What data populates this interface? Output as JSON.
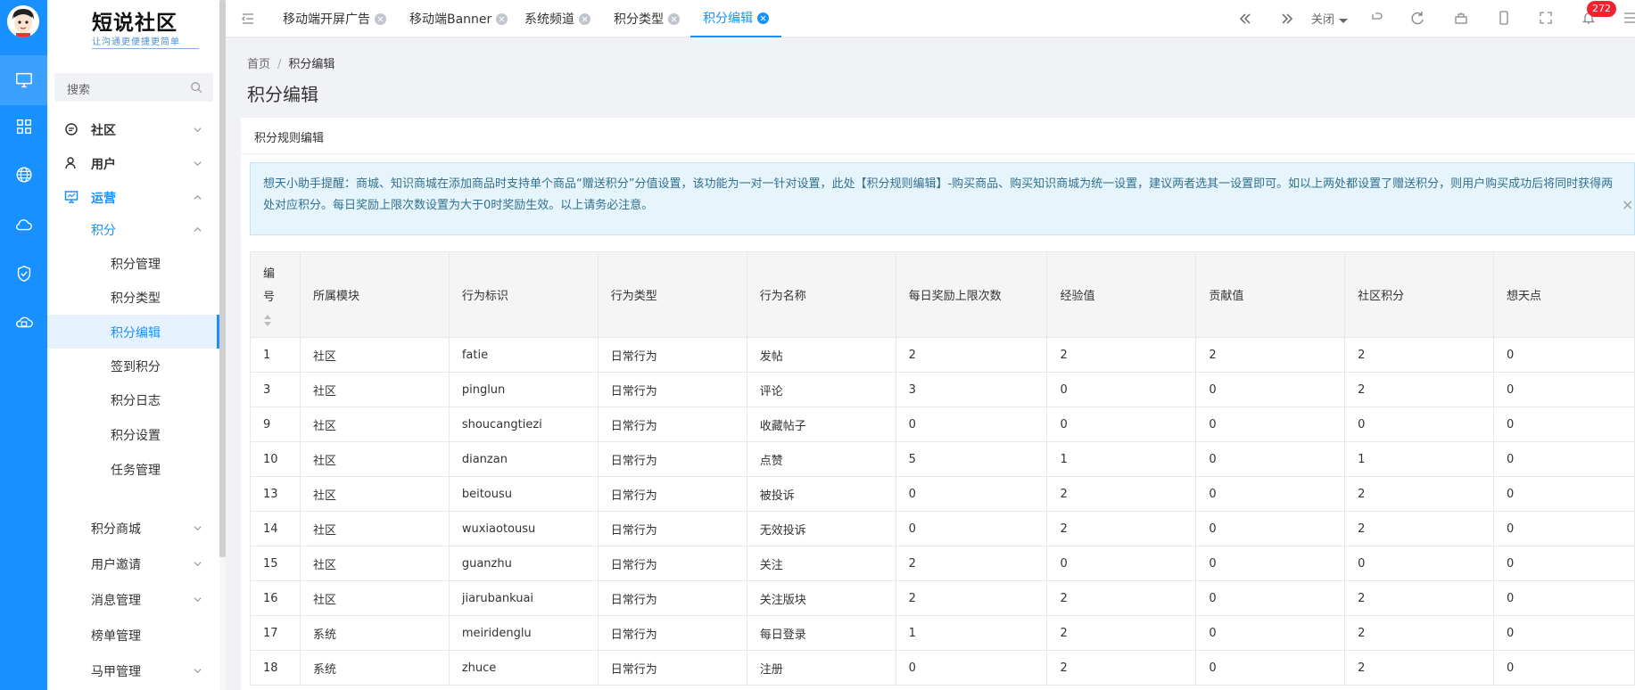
{
  "brand": {
    "title": "短说社区",
    "subtitle": "让沟通更便捷更简单"
  },
  "search": {
    "placeholder": "搜索"
  },
  "sidebar": {
    "items": [
      {
        "label": "社区",
        "icon": "chat-bubble-icon"
      },
      {
        "label": "用户",
        "icon": "user-icon"
      },
      {
        "label": "运营",
        "icon": "monitor-icon"
      },
      {
        "label": "积分"
      },
      {
        "label": "积分管理"
      },
      {
        "label": "积分类型"
      },
      {
        "label": "积分编辑"
      },
      {
        "label": "签到积分"
      },
      {
        "label": "积分日志"
      },
      {
        "label": "积分设置"
      },
      {
        "label": "任务管理"
      },
      {
        "label": "积分商城"
      },
      {
        "label": "用户邀请"
      },
      {
        "label": "消息管理"
      },
      {
        "label": "榜单管理"
      },
      {
        "label": "马甲管理"
      }
    ]
  },
  "tabs": [
    {
      "label": "移动端开屏广告"
    },
    {
      "label": "移动端Banner"
    },
    {
      "label": "系统频道"
    },
    {
      "label": "积分类型"
    },
    {
      "label": "积分编辑"
    }
  ],
  "toolbar": {
    "close_label": "关闭",
    "notification_count": "272"
  },
  "breadcrumb": {
    "home": "首页",
    "current": "积分编辑"
  },
  "page_title": "积分编辑",
  "card": {
    "title": "积分规则编辑",
    "alert": "想天小助手提醒：商城、知识商城在添加商品时支持单个商品“赠送积分”分值设置，该功能为一对一针对设置，此处【积分规则编辑】-购买商品、购买知识商城为统一设置，建议两者选其一设置即可。如以上两处都设置了赠送积分，则用户购买成功后将同时获得两处对应积分。每日奖励上限次数设置为大于0时奖励生效。以上请务必注意。"
  },
  "table": {
    "headers": [
      "编号",
      "所属模块",
      "行为标识",
      "行为类型",
      "行为名称",
      "每日奖励上限次数",
      "经验值",
      "贡献值",
      "社区积分",
      "想天点"
    ],
    "rows": [
      [
        "1",
        "社区",
        "fatie",
        "日常行为",
        "发帖",
        "2",
        "2",
        "2",
        "2",
        "0"
      ],
      [
        "3",
        "社区",
        "pinglun",
        "日常行为",
        "评论",
        "3",
        "0",
        "0",
        "2",
        "0"
      ],
      [
        "9",
        "社区",
        "shoucangtiezi",
        "日常行为",
        "收藏帖子",
        "0",
        "0",
        "0",
        "0",
        "0"
      ],
      [
        "10",
        "社区",
        "dianzan",
        "日常行为",
        "点赞",
        "5",
        "1",
        "0",
        "1",
        "0"
      ],
      [
        "13",
        "社区",
        "beitousu",
        "日常行为",
        "被投诉",
        "0",
        "2",
        "0",
        "2",
        "0"
      ],
      [
        "14",
        "社区",
        "wuxiaotousu",
        "日常行为",
        "无效投诉",
        "0",
        "2",
        "0",
        "2",
        "0"
      ],
      [
        "15",
        "社区",
        "guanzhu",
        "日常行为",
        "关注",
        "2",
        "0",
        "0",
        "0",
        "0"
      ],
      [
        "16",
        "社区",
        "jiarubankuai",
        "日常行为",
        "关注版块",
        "2",
        "2",
        "0",
        "2",
        "0"
      ],
      [
        "17",
        "系统",
        "meiridenglu",
        "日常行为",
        "每日登录",
        "1",
        "2",
        "0",
        "2",
        "0"
      ],
      [
        "18",
        "系统",
        "zhuce",
        "日常行为",
        "注册",
        "0",
        "2",
        "0",
        "2",
        "0"
      ]
    ]
  },
  "colors": {
    "primary": "#1890ff",
    "badge": "#f5222d",
    "alert_bg": "#e6f4fb"
  }
}
